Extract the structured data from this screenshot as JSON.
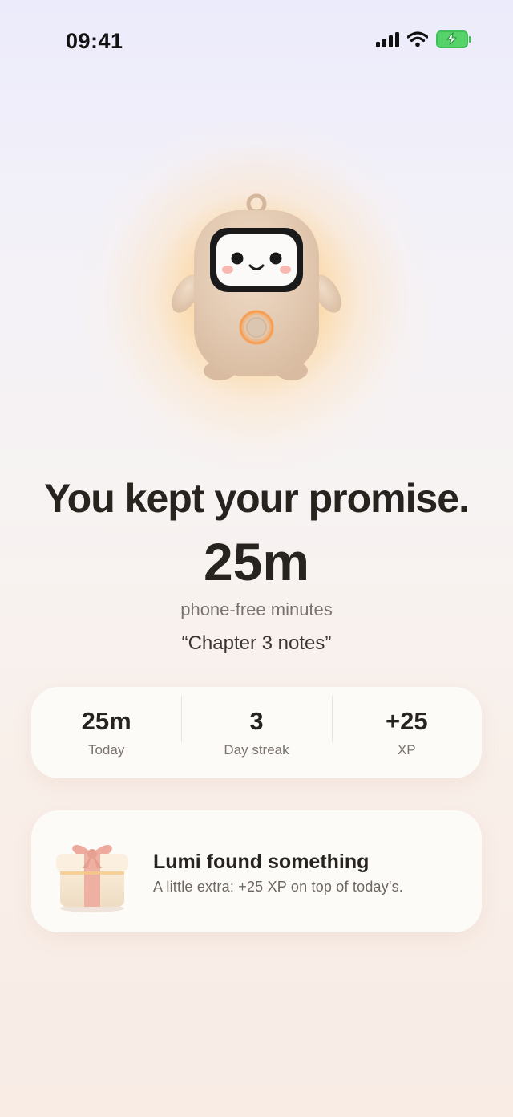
{
  "status_bar": {
    "time": "09:41"
  },
  "hero": {
    "headline": "You kept your promise.",
    "minutes": "25m",
    "minutes_caption": "phone-free minutes",
    "session_name": "“Chapter 3 notes”"
  },
  "stats": [
    {
      "value": "25m",
      "label": "Today"
    },
    {
      "value": "3",
      "label": "Day streak"
    },
    {
      "value": "+25",
      "label": "XP"
    }
  ],
  "reward": {
    "title": "Lumi found something",
    "description": "A little extra: +25 XP on top of today's."
  },
  "icons": [
    "signal-icon",
    "wifi-icon",
    "battery-charging-icon",
    "mascot-illustration",
    "gift-icon"
  ],
  "colors": {
    "glow": "#ffbe5a",
    "battery": "#56d26a",
    "text": "#27231f"
  }
}
